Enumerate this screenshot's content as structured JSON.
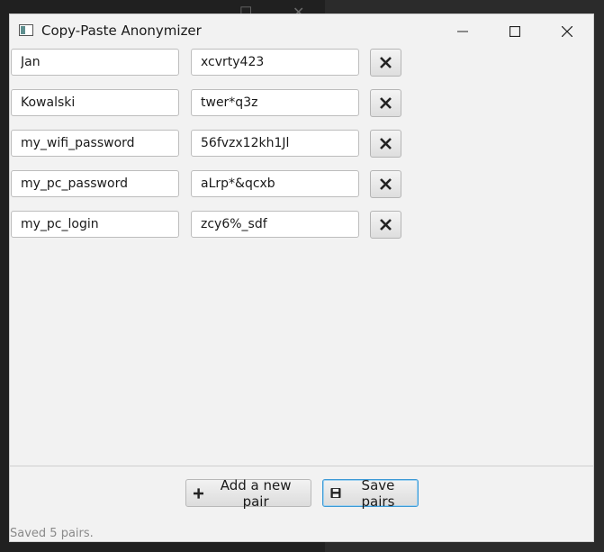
{
  "background_window": {
    "maximize_glyph": "☐",
    "close_glyph": "✕"
  },
  "window": {
    "title": "Copy-Paste Anonymizer",
    "controls": {
      "minimize": "minimize-icon",
      "maximize": "maximize-icon",
      "close": "close-icon"
    }
  },
  "pairs": [
    {
      "original": "Jan",
      "replacement": "xcvrty423"
    },
    {
      "original": "Kowalski",
      "replacement": "twer*q3z"
    },
    {
      "original": "my_wifi_password",
      "replacement": "56fvzx12kh1Jl"
    },
    {
      "original": "my_pc_password",
      "replacement": "aLrp*&qcxb"
    },
    {
      "original": "my_pc_login",
      "replacement": "zcy6%_sdf"
    }
  ],
  "actions": {
    "add_label": "Add a new pair",
    "save_label": "Save pairs"
  },
  "status": "Saved 5 pairs.",
  "colors": {
    "window_bg": "#f2f2f2",
    "focus_border": "#3d9ad6",
    "status_text": "#8a8a8a"
  }
}
